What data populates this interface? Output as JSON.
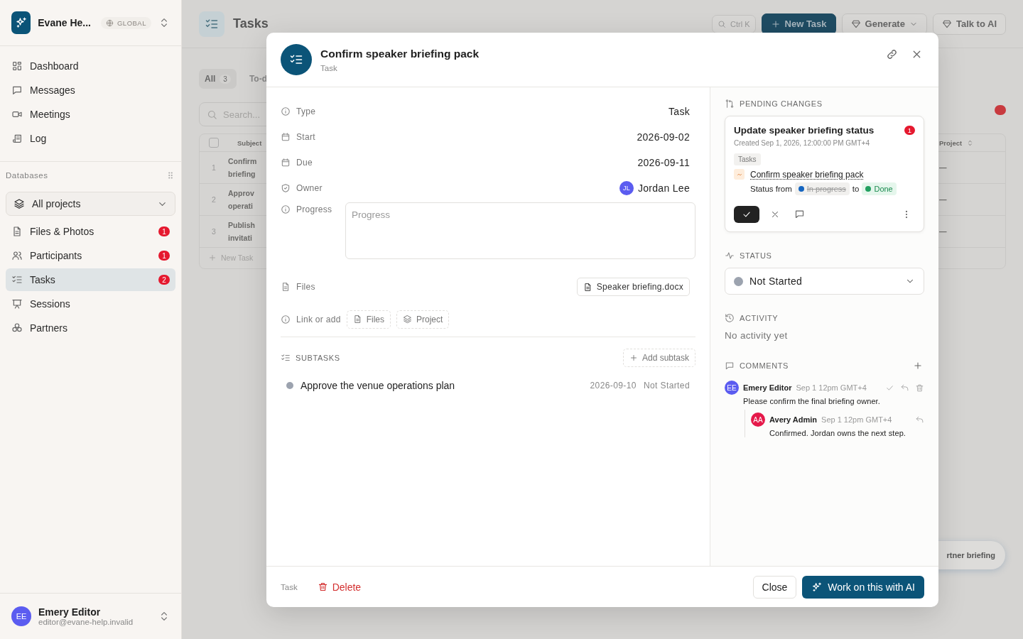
{
  "sidebar": {
    "workspace": {
      "name": "Evane He...",
      "scope": "GLOBAL"
    },
    "nav": [
      {
        "label": "Dashboard",
        "selected": false
      },
      {
        "label": "Messages",
        "selected": false
      },
      {
        "label": "Meetings",
        "selected": false
      },
      {
        "label": "Log",
        "selected": false
      }
    ],
    "databases_heading": "Databases",
    "project_picker": "All projects",
    "databases": [
      {
        "label": "Files & Photos",
        "badge": "1",
        "selected": false
      },
      {
        "label": "Participants",
        "badge": "1",
        "selected": false
      },
      {
        "label": "Tasks",
        "badge": "2",
        "selected": true
      },
      {
        "label": "Sessions",
        "selected": false
      },
      {
        "label": "Partners",
        "selected": false
      }
    ],
    "user": {
      "initials": "EE",
      "name": "Emery Editor",
      "email": "editor@evane-help.invalid"
    }
  },
  "page": {
    "title": "Tasks",
    "search_shortcut": "Ctrl K",
    "buttons": [
      {
        "label": "New Task",
        "kind": "primary"
      },
      {
        "label": "Generate",
        "kind": "menu"
      },
      {
        "label": "Talk to AI",
        "kind": "plain"
      }
    ],
    "tabs": [
      {
        "label": "All",
        "count": "3",
        "selected": true
      },
      {
        "label": "To-d",
        "selected": false
      }
    ],
    "search_placeholder": "Search...",
    "table": {
      "select_all": {
        "checked": false
      },
      "columns": [
        "Subject",
        "Project"
      ],
      "rows": [
        {
          "number": "1",
          "subject": [
            "Confirm",
            "briefing"
          ],
          "project": "—"
        },
        {
          "number": "2",
          "subject": [
            "Approv",
            "operati"
          ],
          "project": "—"
        },
        {
          "number": "3",
          "subject": [
            "Publish",
            "invitati"
          ],
          "project": "—"
        }
      ],
      "add_row": "New Task"
    },
    "toast": "rtner briefing"
  },
  "modal": {
    "title": "Confirm speaker briefing pack",
    "subtitle": "Task",
    "properties": [
      {
        "label": "Type",
        "kind": "text",
        "value": "Task"
      },
      {
        "label": "Start",
        "kind": "text",
        "value": "2026-09-02"
      },
      {
        "label": "Due",
        "kind": "text",
        "value": "2026-09-11"
      },
      {
        "label": "Owner",
        "kind": "person",
        "initials": "JL",
        "value": "Jordan Lee"
      },
      {
        "label": "Progress",
        "kind": "textarea",
        "placeholder": "Progress"
      },
      {
        "label": "Files",
        "kind": "file",
        "value": "Speaker briefing.docx"
      }
    ],
    "link_or_add": {
      "label": "Link or add",
      "options": [
        "Files",
        "Project"
      ]
    },
    "subtasks": {
      "heading": "SUBTASKS",
      "add_button": "Add subtask",
      "items": [
        {
          "title": "Approve the venue operations plan",
          "date": "2026-09-10",
          "status": "Not Started",
          "color": "#9ca3af"
        }
      ]
    },
    "pending_changes": {
      "heading": "PENDING CHANGES",
      "card": {
        "title": "Update speaker briefing status",
        "badge": "1",
        "created": "Created Sep 1, 2026, 12:00:00 PM GMT+4",
        "tag": "Tasks",
        "target": "Confirm speaker briefing pack",
        "status_label": "Status from",
        "from": {
          "label": "In progress",
          "color": "#1565c0"
        },
        "to_label": "to",
        "to": {
          "label": "Done",
          "color": "#22a060"
        }
      }
    },
    "status": {
      "heading": "STATUS",
      "value": "Not Started",
      "color": "#9ca3af"
    },
    "activity": {
      "heading": "ACTIVITY",
      "empty": "No activity yet"
    },
    "comments": {
      "heading": "COMMENTS",
      "items": [
        {
          "initials": "EE",
          "author": "Emery Editor",
          "time": "Sep 1 12pm GMT+4",
          "text": "Please confirm the final briefing owner.",
          "color": "#5b5cf0",
          "children": [
            {
              "initials": "AA",
              "author": "Avery Admin",
              "time": "Sep 1 12pm GMT+4",
              "text": "Confirmed. Jordan owns the next step.",
              "color": "#e5194a"
            }
          ]
        }
      ]
    },
    "footer": {
      "type_label": "Task",
      "delete": "Delete",
      "close": "Close",
      "ai": "Work on this with AI"
    }
  }
}
